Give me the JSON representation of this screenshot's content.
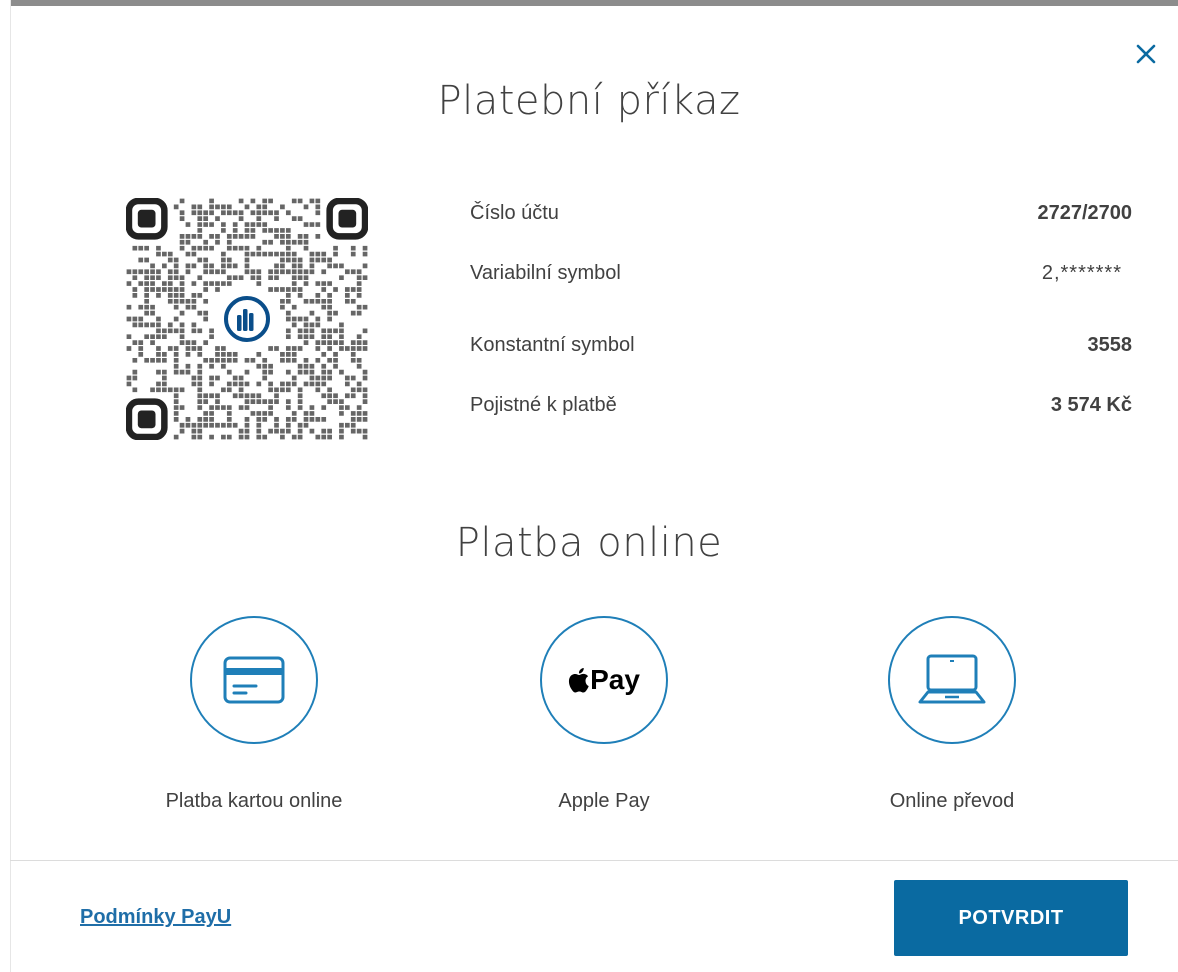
{
  "dialog": {
    "title": "Platební příkaz",
    "close_icon": "close-icon"
  },
  "payment_order": {
    "rows": [
      {
        "label": "Číslo účtu",
        "value": "2727/2700"
      },
      {
        "label": "Variabilní symbol",
        "value": "2,*******"
      },
      {
        "label": "Konstantní symbol",
        "value": "3558"
      },
      {
        "label": "Pojistné k platbě",
        "value": "3 574 Kč"
      }
    ],
    "qr_icon": "qr-code-icon"
  },
  "online": {
    "title": "Platba online",
    "methods": [
      {
        "label": "Platba kartou online",
        "icon": "credit-card-icon"
      },
      {
        "label": "Apple Pay",
        "icon": "apple-pay-icon",
        "icon_text": "Pay"
      },
      {
        "label": "Online převod",
        "icon": "laptop-icon"
      }
    ]
  },
  "footer": {
    "terms_link": "Podmínky PayU",
    "confirm_button": "POTVRDIT"
  },
  "colors": {
    "accent": "#1f7fb8",
    "button": "#0a6aa1",
    "link": "#1f6ea8",
    "text": "#414141"
  }
}
